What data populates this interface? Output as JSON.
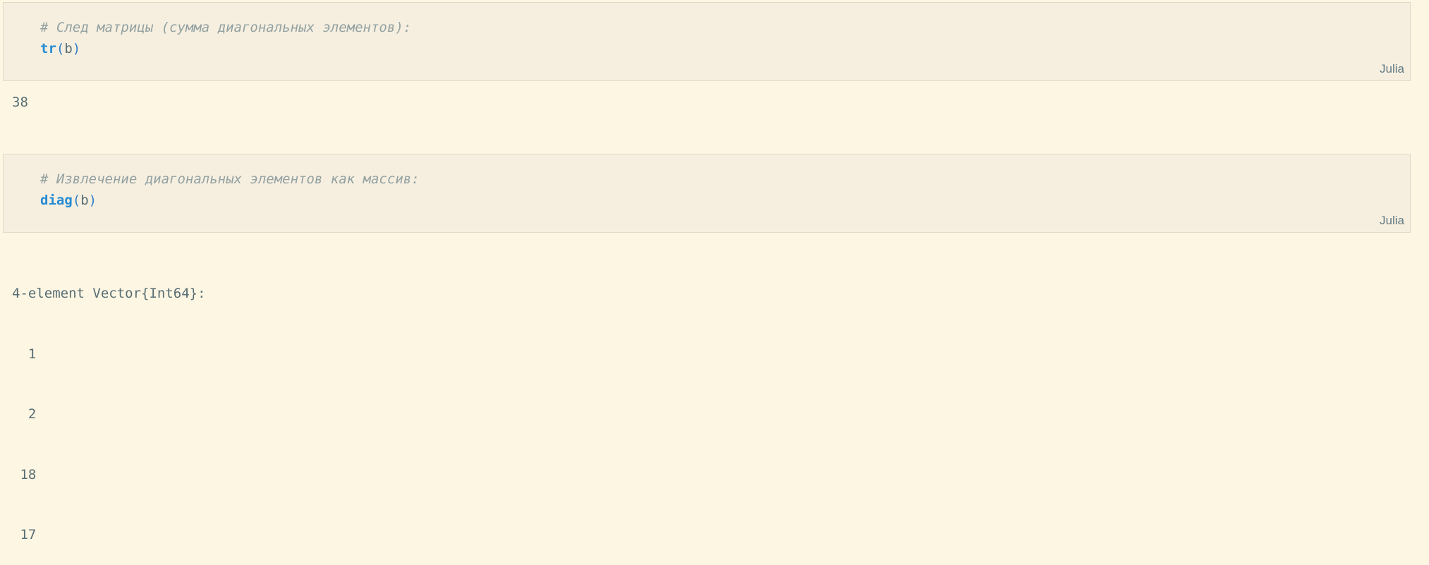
{
  "cells": [
    {
      "comment": "# След матрицы (сумма диагональных элементов):",
      "function": "tr",
      "open_paren": "(",
      "argument": "b",
      "close_paren": ")",
      "language": "Julia",
      "output": "38"
    },
    {
      "comment": "# Извлечение диагональных элементов как массив:",
      "function": "diag",
      "open_paren": "(",
      "argument": "b",
      "close_paren": ")",
      "language": "Julia",
      "output_header": "4-element Vector{Int64}:",
      "output_values": [
        "  1",
        "  2",
        " 18",
        " 17"
      ]
    }
  ]
}
